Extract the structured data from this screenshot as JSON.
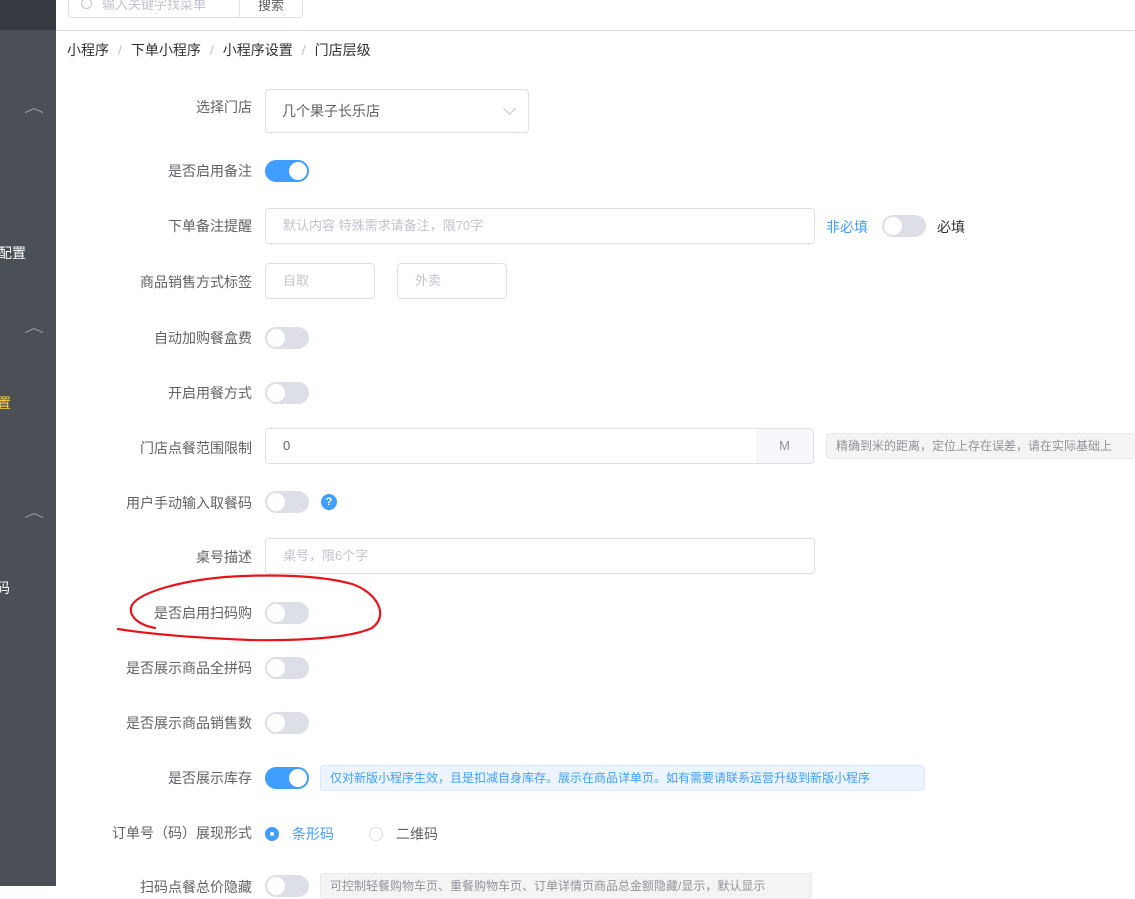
{
  "sidebar": {
    "items": [
      {
        "label": "配置",
        "active": false
      },
      {
        "label": "置",
        "active": true
      },
      {
        "label": "码",
        "active": false
      }
    ]
  },
  "topbar": {
    "search_placeholder": "输入关键字找菜单",
    "search_button": "搜索"
  },
  "breadcrumb": [
    "小程序",
    "下单小程序",
    "小程序设置",
    "门店层级"
  ],
  "form": {
    "store": {
      "label": "选择门店",
      "value": "几个果子长乐店"
    },
    "enable_remark": {
      "label": "是否启用备注",
      "on": true
    },
    "remark_hint": {
      "label": "下单备注提醒",
      "placeholder": "默认内容 特殊需求请备注，限70字",
      "optional_label": "非必填",
      "required_label": "必填",
      "required_on": false
    },
    "sale_mode": {
      "label": "商品销售方式标签",
      "pickup_placeholder": "自取",
      "delivery_placeholder": "外卖"
    },
    "box_fee": {
      "label": "自动加购餐盒费",
      "on": false
    },
    "dining_mode": {
      "label": "开启用餐方式",
      "on": false
    },
    "range_limit": {
      "label": "门店点餐范围限制",
      "value": "0",
      "unit": "M",
      "tip": "精确到米的距离，定位上存在误差，请在实际基础上"
    },
    "manual_code": {
      "label": "用户手动输入取餐码",
      "on": false,
      "help_icon": "question-circle-icon"
    },
    "table_desc": {
      "label": "桌号描述",
      "placeholder": "桌号，限6个字"
    },
    "scan_buy": {
      "label": "是否启用扫码购",
      "on": false
    },
    "show_pinyin": {
      "label": "是否展示商品全拼码",
      "on": false
    },
    "show_sales": {
      "label": "是否展示商品销售数",
      "on": false
    },
    "show_stock": {
      "label": "是否展示库存",
      "on": true,
      "tip": "仅对新版小程序生效，且是扣减自身库存。展示在商品详单页。如有需要请联系运营升级到新版小程序"
    },
    "order_code": {
      "label": "订单号（码）展现形式",
      "options": [
        "条形码",
        "二维码"
      ],
      "selected": "条形码"
    },
    "hide_total": {
      "label": "扫码点餐总价隐藏",
      "on": false,
      "tip": "可控制轻餐购物车页、重餐购物车页、订单详情页商品总金额隐藏/显示，默认显示"
    }
  },
  "colors": {
    "primary": "#409eff",
    "sidebar_bg": "#4a5056",
    "sidebar_active": "#ffd04b",
    "annotation": "#e8141b"
  }
}
